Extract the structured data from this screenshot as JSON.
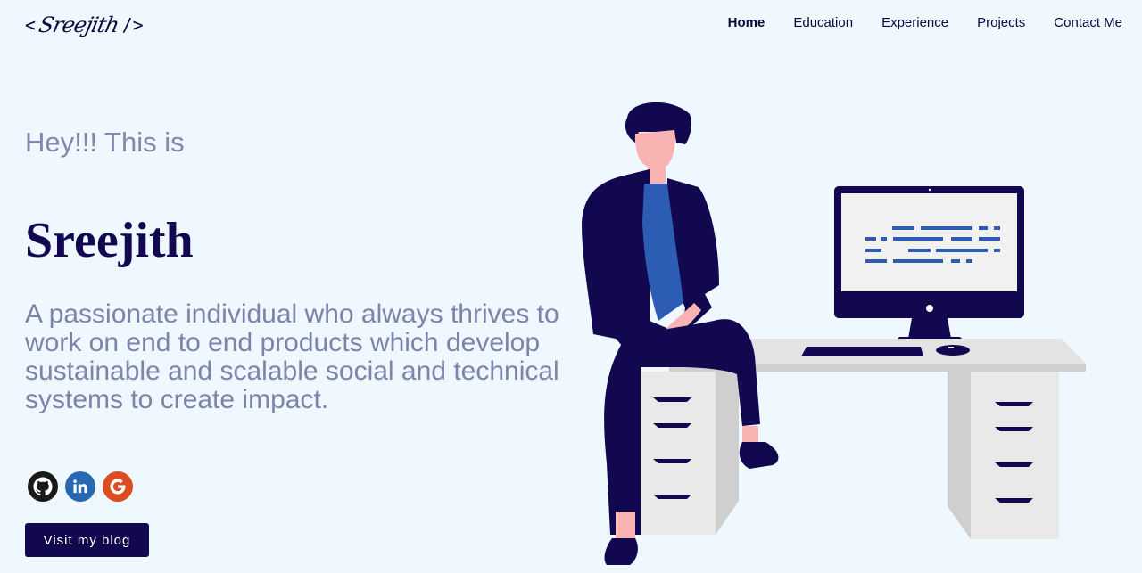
{
  "header": {
    "logo": {
      "open": "<",
      "signature": "Sreejith",
      "close": "/>"
    },
    "nav": [
      {
        "label": "Home",
        "active": true
      },
      {
        "label": "Education",
        "active": false
      },
      {
        "label": "Experience",
        "active": false
      },
      {
        "label": "Projects",
        "active": false
      },
      {
        "label": "Contact Me",
        "active": false
      }
    ]
  },
  "hero": {
    "greeting": "Hey!!! This is",
    "name": "Sreejith",
    "tagline": "A passionate individual who always thrives to work on end to end products which develop sustainable and scalable social and technical systems to create impact.",
    "socials": [
      {
        "icon": "github-icon",
        "color": "#1a1a1a"
      },
      {
        "icon": "linkedin-icon",
        "color": "#2867b2"
      },
      {
        "icon": "google-icon",
        "color": "#dd4b23"
      }
    ],
    "blog_button": "Visit my blog"
  },
  "colors": {
    "background": "#eef8fe",
    "navy": "#12084f",
    "muted_text": "#7d84aa",
    "skin": "#f9a8a8",
    "shirt": "#2d5cb5",
    "desk": "#e6e6e6"
  }
}
